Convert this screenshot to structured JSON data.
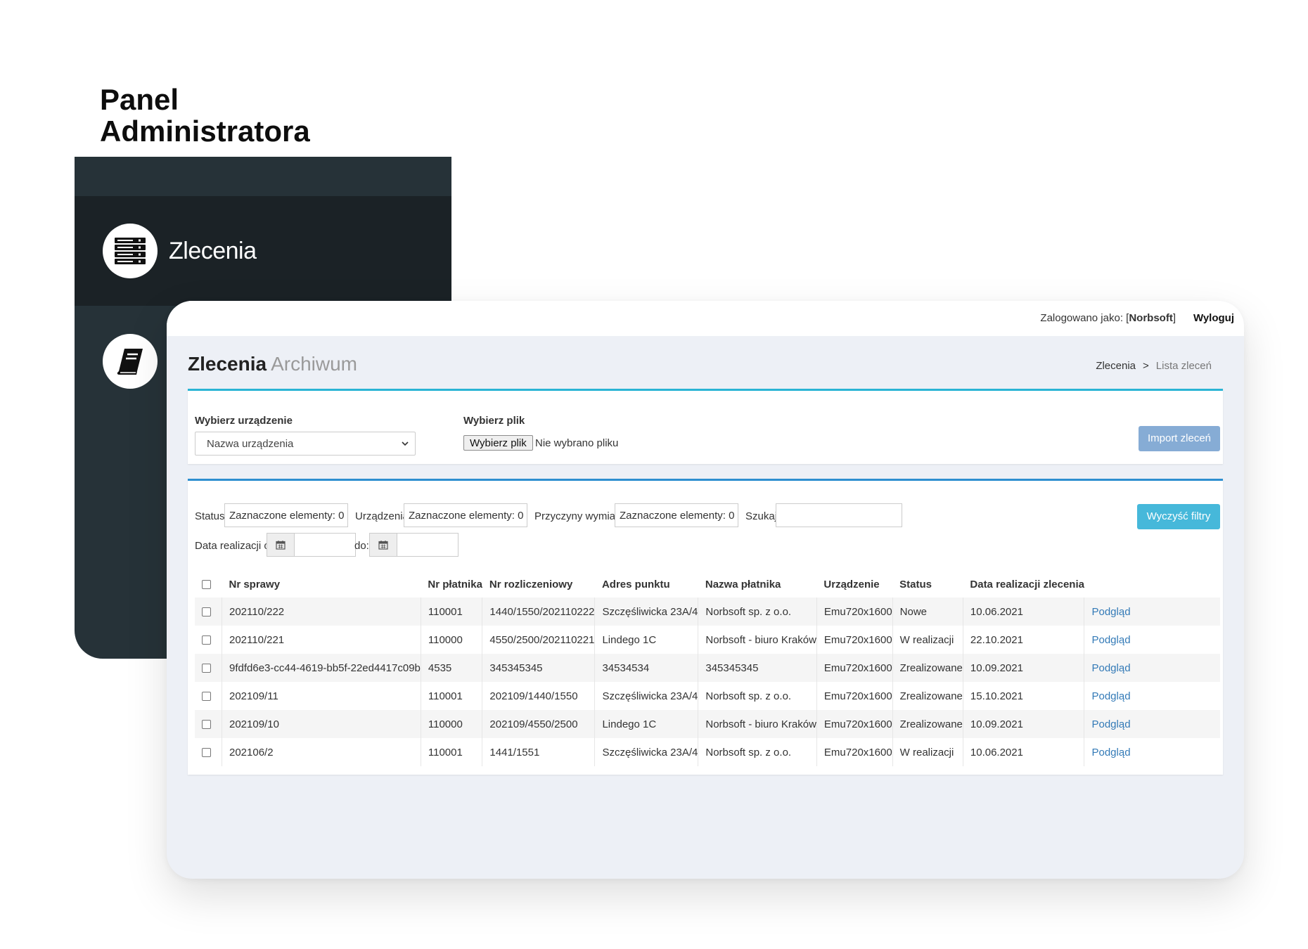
{
  "admin": {
    "title_line1": "Panel",
    "title_line2": "Administratora",
    "menu": [
      {
        "label": "Zlecenia",
        "icon": "server-list-icon"
      },
      {
        "label": "",
        "icon": "book-icon"
      }
    ]
  },
  "topbar": {
    "logged_prefix": "Zalogowano jako: [",
    "user": "Norbsoft",
    "logged_suffix": "]",
    "logout": "Wyloguj"
  },
  "page": {
    "title": "Zlecenia",
    "subtitle": "Archiwum",
    "breadcrumb": [
      "Zlecenia",
      ">",
      "Lista zleceń"
    ]
  },
  "import": {
    "device_label": "Wybierz urządzenie",
    "device_value": "Nazwa urządzenia",
    "file_label": "Wybierz plik",
    "file_button": "Wybierz plik",
    "file_status": "Nie wybrano pliku",
    "import_button": "Import zleceń"
  },
  "filters": {
    "status_label": "Status:",
    "status_value": "Zaznaczone elementy: 0",
    "devices_label": "Urządzenia:",
    "devices_value": "Zaznaczone elementy: 0",
    "reasons_label": "Przyczyny wymiany:",
    "reasons_value": "Zaznaczone elementy: 0",
    "search_label": "Szukaj:",
    "search_value": "",
    "date_from_label": "Data realizacji od:",
    "date_to_label": "do:",
    "clear_button": "Wyczyść filtry"
  },
  "table": {
    "columns": [
      "Nr sprawy",
      "Nr płatnika",
      "Nr rozliczeniowy",
      "Adres punktu",
      "Nazwa płatnika",
      "Urządzenie",
      "Status",
      "Data realizacji zlecenia",
      ""
    ],
    "rows": [
      [
        "202110/222",
        "110001",
        "1440/1550/202110222",
        "Szczęśliwicka 23A/4",
        "Norbsoft sp. z o.o.",
        "Emu720x1600",
        "Nowe",
        "10.06.2021",
        "Podgląd"
      ],
      [
        "202110/221",
        "110000",
        "4550/2500/202110221",
        "Lindego 1C",
        "Norbsoft - biuro Kraków",
        "Emu720x1600",
        "W realizacji",
        "22.10.2021",
        "Podgląd"
      ],
      [
        "9fdfd6e3-cc44-4619-bb5f-22ed4417c09b",
        "4535",
        "345345345",
        "34534534",
        "345345345",
        "Emu720x1600",
        "Zrealizowane",
        "10.09.2021",
        "Podgląd"
      ],
      [
        "202109/11",
        "110001",
        "202109/1440/1550",
        "Szczęśliwicka 23A/4",
        "Norbsoft sp. z o.o.",
        "Emu720x1600",
        "Zrealizowane",
        "15.10.2021",
        "Podgląd"
      ],
      [
        "202109/10",
        "110000",
        "202109/4550/2500",
        "Lindego 1C",
        "Norbsoft - biuro Kraków",
        "Emu720x1600",
        "Zrealizowane",
        "10.09.2021",
        "Podgląd"
      ],
      [
        "202106/2",
        "110001",
        "1441/1551",
        "Szczęśliwicka 23A/4",
        "Norbsoft sp. z o.o.",
        "Emu720x1600",
        "W realizacji",
        "10.06.2021",
        "Podgląd"
      ]
    ]
  },
  "colors": {
    "sidebar": "#263238",
    "accent_top": "#2ab4d4",
    "import_button": "#86acd5",
    "clear_button": "#46b8da",
    "link": "#337ab7"
  }
}
